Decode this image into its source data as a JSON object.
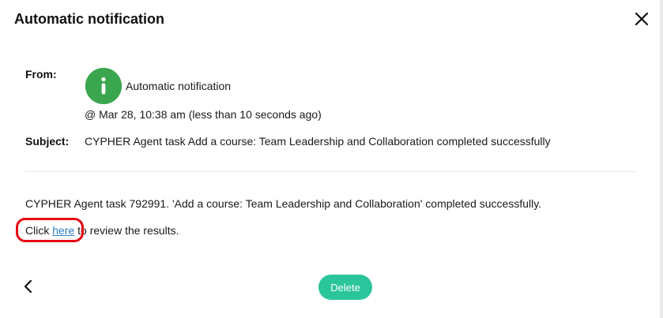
{
  "dialog": {
    "title": "Automatic notification"
  },
  "message": {
    "from_label": "From:",
    "sender_name": "Automatic notification",
    "sender_icon": "info-icon",
    "timestamp": "@ Mar 28, 10:38 am (less than 10 seconds ago)",
    "subject_label": "Subject:",
    "subject": "CYPHER Agent task Add a course: Team Leadership and Collaboration completed successfully",
    "body_line": "CYPHER Agent task 792991. 'Add a course: Team Leadership and Collaboration' completed successfully.",
    "click_prefix": "Click ",
    "link_text": "here",
    "click_suffix": " to review the results."
  },
  "footer": {
    "delete_label": "Delete"
  },
  "colors": {
    "accent": "#2bc59b",
    "avatar": "#3aa64e",
    "link": "#2a7fc7",
    "highlight": "#e60012"
  }
}
